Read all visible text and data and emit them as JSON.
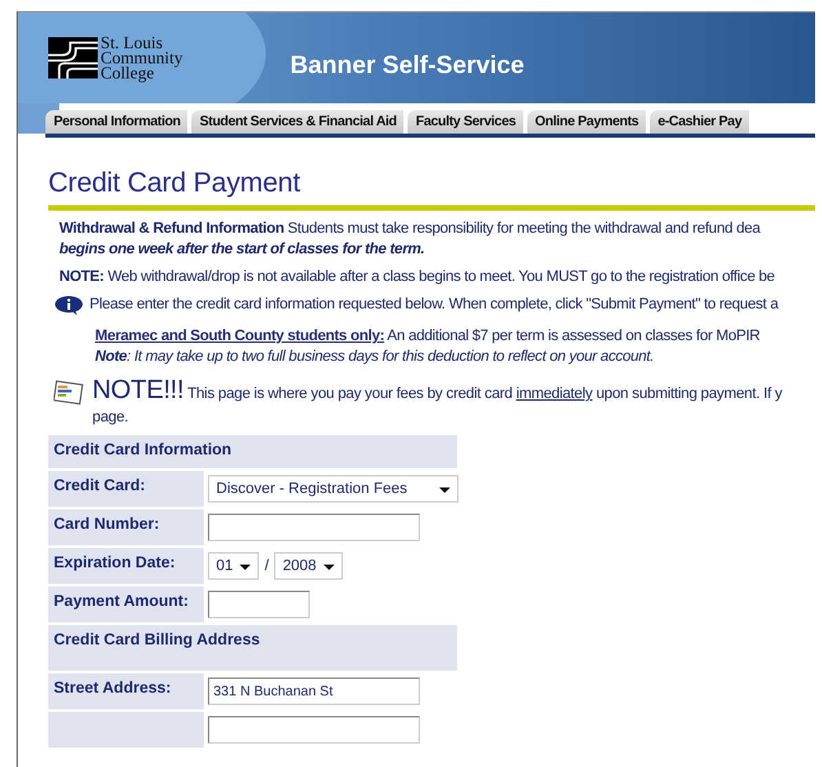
{
  "header": {
    "logo_text": [
      "St. Louis",
      "Community",
      "College"
    ],
    "title": "Banner Self-Service"
  },
  "tabs": [
    {
      "label": "Personal Information"
    },
    {
      "label": "Student Services & Financial Aid"
    },
    {
      "label": "Faculty Services"
    },
    {
      "label": "Online Payments"
    },
    {
      "label": "e-Cashier Pay"
    }
  ],
  "page_title": "Credit Card Payment",
  "notices": [
    {
      "kind": "para",
      "text": "**Withdrawal & Refund Information** Students must take responsibility for meeting the withdrawal and refund dea"
    },
    {
      "kind": "emph",
      "text": "begins one week after the start of classes for the term."
    },
    {
      "kind": "para",
      "text": "**NOTE:** Web withdrawal/drop is not available after a class begins to meet. You MUST go to the registration office be"
    },
    {
      "kind": "info",
      "text": "Please enter the credit card information requested below. When complete, click \"Submit Payment\" to request a"
    },
    {
      "kind": "indent",
      "link": "Meramec and South County students only:",
      "text": " An additional $7 per term is assessed on classes for MoPIR"
    },
    {
      "kind": "indent-italic",
      "text": "**Note**: It may take up to two full business days for this deduction to reflect on your account."
    }
  ],
  "big_note": {
    "heading": "NOTE!!!",
    "before": "This page is where you pay your fees by credit card ",
    "link": "immediately",
    "after": " upon submitting payment. If y",
    "line2": "page."
  },
  "form": [
    {
      "kind": "section",
      "label": "Credit Card Information"
    },
    {
      "kind": "select",
      "label": "Credit Card:",
      "value": "Discover - Registration Fees"
    },
    {
      "kind": "input",
      "label": "Card Number:"
    },
    {
      "kind": "date",
      "label": "Expiration Date:",
      "month": "01",
      "separator": "/",
      "year": "2008"
    },
    {
      "kind": "input-short",
      "label": "Payment Amount:"
    },
    {
      "kind": "section",
      "label": "Credit Card Billing Address"
    },
    {
      "kind": "input",
      "label": "Street Address:",
      "value": "331 N Buchanan St"
    },
    {
      "kind": "input"
    }
  ]
}
